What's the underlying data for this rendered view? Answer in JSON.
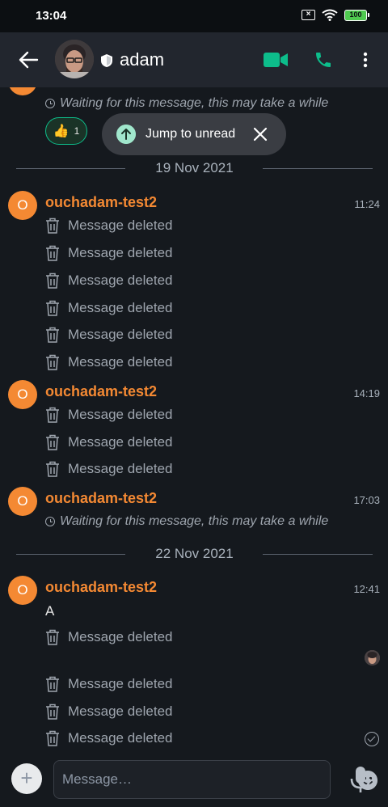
{
  "status_bar": {
    "time": "13:04",
    "battery": "100"
  },
  "header": {
    "room_name": "adam"
  },
  "top_fragment": {
    "waiting_text": "Waiting for this message, this may take a while",
    "reaction_emoji": "👍",
    "reaction_count": "1"
  },
  "jump": {
    "label": "Jump to unread"
  },
  "dates": [
    "19 Nov 2021",
    "22 Nov 2021"
  ],
  "groups": [
    {
      "avatar_letter": "O",
      "sender": "ouchadam-test2",
      "time": "11:24",
      "messages": [
        "Message deleted",
        "Message deleted",
        "Message deleted",
        "Message deleted",
        "Message deleted",
        "Message deleted"
      ]
    },
    {
      "avatar_letter": "O",
      "sender": "ouchadam-test2",
      "time": "14:19",
      "messages": [
        "Message deleted",
        "Message deleted",
        "Message deleted"
      ]
    },
    {
      "avatar_letter": "O",
      "sender": "ouchadam-test2",
      "time": "17:03",
      "waiting_text": "Waiting for this message, this may take a while"
    },
    {
      "avatar_letter": "O",
      "sender": "ouchadam-test2",
      "time": "12:41",
      "text": "A",
      "messages": [
        "Message deleted",
        "Message deleted",
        "Message deleted",
        "Message deleted"
      ]
    }
  ],
  "composer": {
    "placeholder": "Message…"
  },
  "colors": {
    "accent": "#0dbd8b",
    "sender": "#f48933",
    "background": "#15191e",
    "header": "#22262e"
  },
  "icons": [
    "back-arrow-icon",
    "shield-icon",
    "video-call-icon",
    "phone-icon",
    "more-vertical-icon",
    "clock-icon",
    "arrow-up-icon",
    "close-icon",
    "trash-icon",
    "plus-icon",
    "emoji-icon",
    "microphone-icon",
    "check-circle-icon"
  ]
}
